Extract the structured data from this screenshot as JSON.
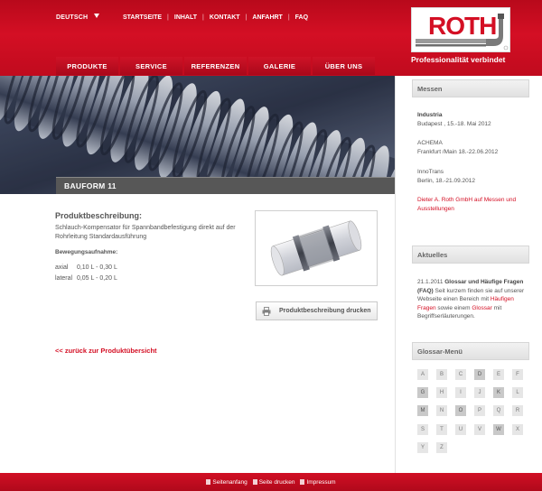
{
  "header": {
    "language": "DEUTSCH",
    "top_links": [
      "STARTSEITE",
      "INHALT",
      "KONTAKT",
      "ANFAHRT",
      "FAQ"
    ],
    "logo_text": "ROTH",
    "tagline": "Professionalität verbindet",
    "main_nav": [
      {
        "label": "PRODUKTE",
        "width": 69
      },
      {
        "label": "SERVICE",
        "width": 69
      },
      {
        "label": "REFERENZEN",
        "width": 69
      },
      {
        "label": "GALERIE",
        "width": 69
      },
      {
        "label": "ÜBER UNS",
        "width": 69
      }
    ]
  },
  "hero": {
    "caption": "BAUFORM 11"
  },
  "product": {
    "desc_title": "Produktbeschreibung:",
    "desc_text": "Schlauch-Kompensator für Spannbandbefestigung direkt auf der Rohrleitung Standardausführung",
    "movement_title": "Bewegungsaufnahme:",
    "movements": [
      {
        "label": "axial",
        "value": "0,10 L - 0,30 L"
      },
      {
        "label": "lateral",
        "value": "0,05 L - 0,20 L"
      }
    ],
    "print_label": "Produktbeschreibung drucken",
    "back_link": "<< zurück zur Produktübersicht"
  },
  "sidebar": {
    "messen_title": "Messen",
    "events": [
      {
        "name": "Industria",
        "detail": "Budapest , 15.-18. Mai 2012"
      },
      {
        "name": "ACHEMA",
        "detail": "Frankfurt /Main 18.-22.06.2012"
      },
      {
        "name": "InnoTrans",
        "detail": "Berlin, 18.-21.09.2012"
      }
    ],
    "messen_link": "Dieter A. Roth GmbH auf Messen und Ausstellungen",
    "aktuelles_title": "Aktuelles",
    "news": {
      "date": "21.1.2011",
      "headline": "Glossar und Häufige Fragen (FAQ)",
      "text_1": "Seit kurzem finden sie auf unserer Webseite einen Bereich mit",
      "link_1": "Häufigen Fragen",
      "text_2": "sowie einem",
      "link_2": "Glossar",
      "text_3": "mit Begriffserläuterungen."
    },
    "glossar_title": "Glossar-Menü",
    "letters": [
      "A",
      "B",
      "C",
      "D",
      "E",
      "F",
      "G",
      "H",
      "I",
      "J",
      "K",
      "L",
      "M",
      "N",
      "O",
      "P",
      "Q",
      "R",
      "S",
      "T",
      "U",
      "V",
      "W",
      "X",
      "Y",
      "Z"
    ],
    "active_letters": [
      "D",
      "G",
      "K",
      "M",
      "O",
      "W"
    ]
  },
  "footer": {
    "links": [
      "Seitenanfang",
      "Seite drucken",
      "Impressum"
    ]
  },
  "colors": {
    "brand_red": "#d40f24",
    "caption_grey": "#575757"
  }
}
